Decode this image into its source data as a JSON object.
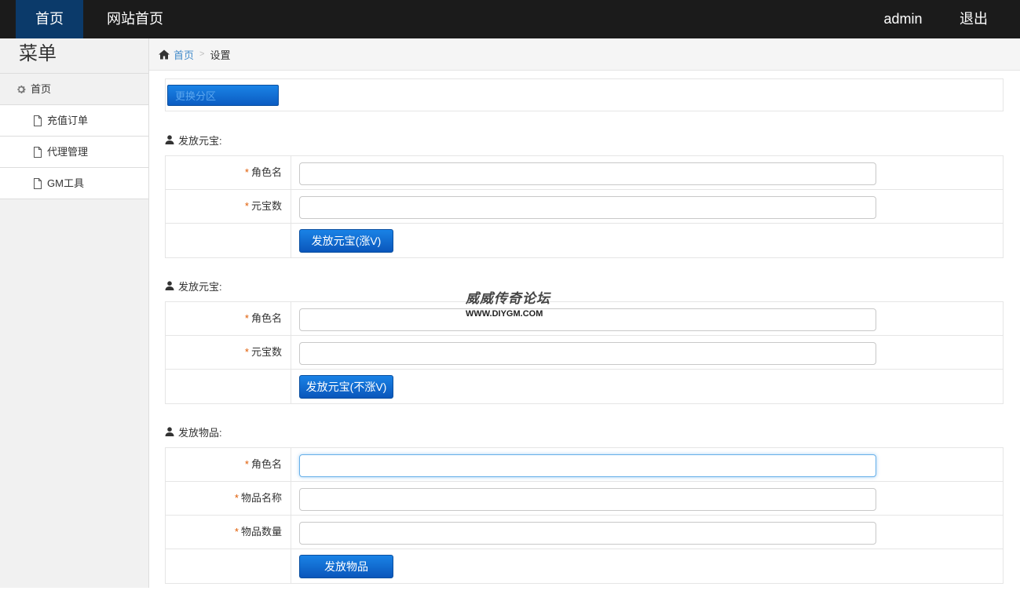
{
  "topnav": {
    "home": "首页",
    "site_home": "网站首页",
    "user": "admin",
    "logout": "退出"
  },
  "sidebar": {
    "title": "菜单",
    "home": "首页",
    "items": [
      {
        "label": "充值订单"
      },
      {
        "label": "代理管理"
      },
      {
        "label": "GM工具"
      }
    ]
  },
  "breadcrumb": {
    "home": "首页",
    "separator": ">",
    "current": "设置"
  },
  "partition": {
    "button_label": "更换分区"
  },
  "sections": [
    {
      "title": "发放元宝:",
      "fields": [
        {
          "label": "角色名",
          "value": "",
          "placeholder": ""
        },
        {
          "label": "元宝数",
          "value": "",
          "placeholder": ""
        }
      ],
      "submit_label": "发放元宝(涨V)"
    },
    {
      "title": "发放元宝:",
      "fields": [
        {
          "label": "角色名",
          "value": "",
          "placeholder": ""
        },
        {
          "label": "元宝数",
          "value": "",
          "placeholder": ""
        }
      ],
      "submit_label": "发放元宝(不涨V)"
    },
    {
      "title": "发放物品:",
      "fields": [
        {
          "label": "角色名",
          "value": "",
          "placeholder": ""
        },
        {
          "label": "物品名称",
          "value": "",
          "placeholder": ""
        },
        {
          "label": "物品数量",
          "value": "",
          "placeholder": ""
        }
      ],
      "submit_label": "发放物品"
    }
  ],
  "required_mark": "*",
  "watermark": {
    "name": "威威传奇论坛",
    "url": "WWW.DIYGM.COM"
  },
  "colors": {
    "topbar_bg": "#1b1b1b",
    "active_nav_bg": "#0b3a6a",
    "button_blue": "#0b5cc2",
    "link_blue": "#428bca",
    "required_orange": "#e05a00"
  }
}
